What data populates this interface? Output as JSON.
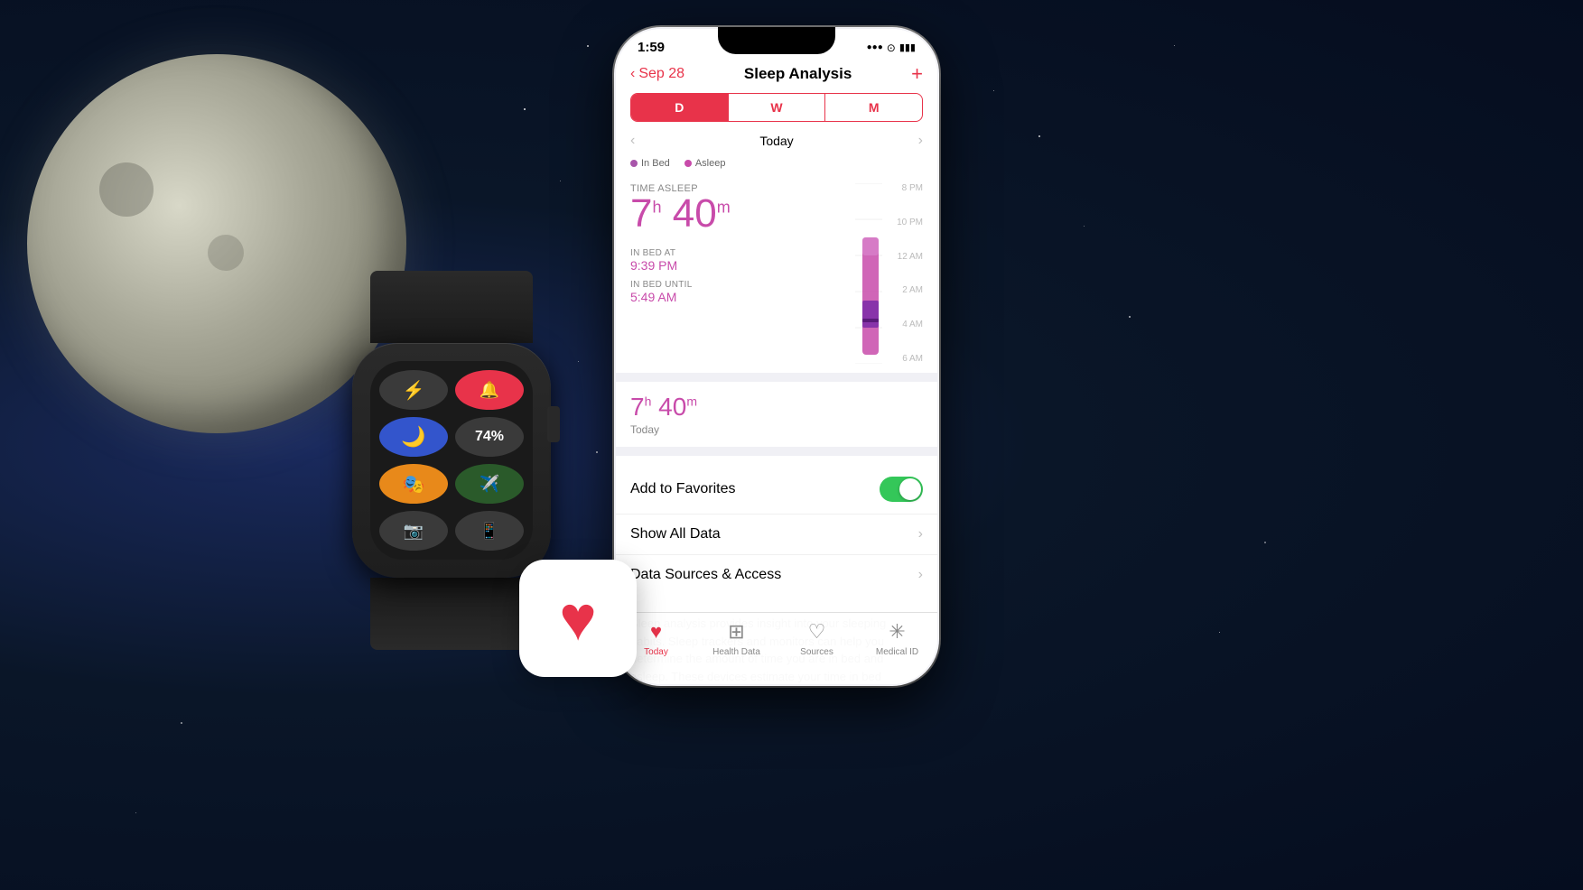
{
  "background": {
    "color": "#0a1628"
  },
  "status_bar": {
    "time": "1:59",
    "signal": "●●●●",
    "wifi": "wifi",
    "battery": "battery"
  },
  "nav": {
    "back_label": "Sep 28",
    "title": "Sleep Analysis",
    "add_icon": "+"
  },
  "period_selector": {
    "options": [
      "D",
      "W",
      "M"
    ],
    "active": "D"
  },
  "date_nav": {
    "label": "Today",
    "prev_icon": "‹",
    "next_icon": "›"
  },
  "legend": {
    "items": [
      {
        "label": "In Bed",
        "color": "#a855aa"
      },
      {
        "label": "Asleep",
        "color": "#c84baa"
      }
    ]
  },
  "sleep_data": {
    "time_asleep_label": "TIME ASLEEP",
    "hours": "7",
    "minutes": "40",
    "h_suffix": "h",
    "m_suffix": "m",
    "in_bed_at_label": "IN BED AT",
    "in_bed_at_value": "9:39 PM",
    "in_bed_until_label": "IN BED UNTIL",
    "in_bed_until_value": "5:49 AM"
  },
  "chart": {
    "time_labels": [
      "8 PM",
      "10 PM",
      "12 AM",
      "2 AM",
      "4 AM",
      "6 AM"
    ]
  },
  "summary": {
    "hours": "7",
    "h_suffix": "h",
    "minutes": "40",
    "m_suffix": "m",
    "sublabel": "Today"
  },
  "actions": {
    "add_to_favorites": {
      "label": "Add to Favorites",
      "toggle": true
    },
    "show_all_data": {
      "label": "Show All Data"
    },
    "data_sources": {
      "label": "Data Sources & Access"
    }
  },
  "description": {
    "text": "Sleep analysis provides insight into your sleeping habits. Sleep trackers and monitors can help you determine the amount of time you are in bed and asleep. These devices estimate your time in bed"
  },
  "tabs": [
    {
      "label": "Today",
      "icon": "♥",
      "active": true
    },
    {
      "label": "Health Data",
      "icon": "⊞",
      "active": false
    },
    {
      "label": "Sources",
      "icon": "♡",
      "active": false
    },
    {
      "label": "Medical ID",
      "icon": "✳",
      "active": false
    }
  ],
  "watch": {
    "battery_percent": "74%",
    "buttons": [
      {
        "label": "🔦",
        "bg": "#3a3a3a",
        "name": "flashlight"
      },
      {
        "label": "🔔",
        "bg": "#e8334a",
        "name": "bell-muted"
      },
      {
        "label": "🌙",
        "bg": "#3355cc",
        "name": "moon"
      },
      {
        "label": "74%",
        "bg": "#3a3a3a",
        "name": "battery"
      },
      {
        "label": "🎭",
        "bg": "#e8891a",
        "name": "theater"
      },
      {
        "label": "✈",
        "bg": "#2a4a2a",
        "name": "airplane"
      },
      {
        "label": "📷",
        "bg": "#3a3a3a",
        "name": "camera"
      },
      {
        "label": "📱",
        "bg": "#3a3a3a",
        "name": "phone"
      }
    ]
  }
}
